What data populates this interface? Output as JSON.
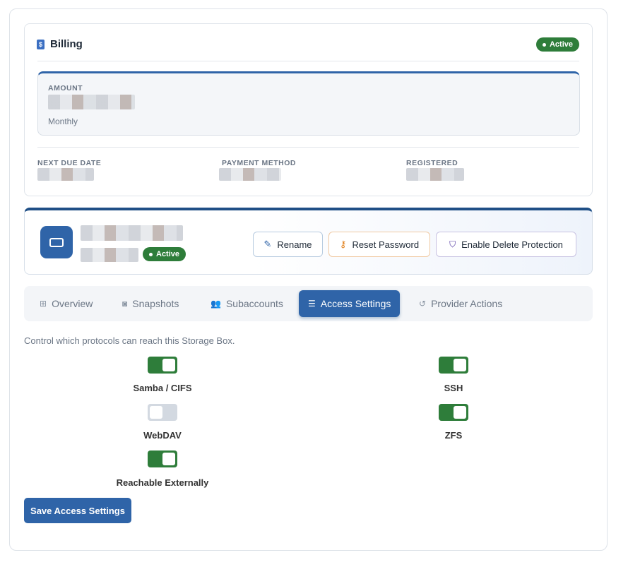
{
  "billing": {
    "title": "Billing",
    "icon": "billing-doc-icon",
    "status": "Active",
    "amount_label": "AMOUNT",
    "amount_period": "Monthly",
    "next_due_label": "NEXT DUE DATE",
    "payment_method_label": "PAYMENT METHOD",
    "registered_label": "REGISTERED"
  },
  "server": {
    "icon": "storage-box-icon",
    "status": "Active",
    "actions": {
      "rename": "Rename",
      "reset_password": "Reset Password",
      "enable_delete_protection": "Enable Delete Protection"
    }
  },
  "tabs": [
    {
      "label": "Overview",
      "icon": "grid-icon"
    },
    {
      "label": "Snapshots",
      "icon": "camera-icon"
    },
    {
      "label": "Subaccounts",
      "icon": "users-icon"
    },
    {
      "label": "Access Settings",
      "icon": "sliders-icon",
      "active": true
    },
    {
      "label": "Provider Actions",
      "icon": "history-icon"
    }
  ],
  "access": {
    "description": "Control which protocols can reach this Storage Box.",
    "toggles": [
      {
        "label": "Samba / CIFS",
        "on": true
      },
      {
        "label": "SSH",
        "on": true
      },
      {
        "label": "WebDAV",
        "on": false
      },
      {
        "label": "ZFS",
        "on": true
      },
      {
        "label": "Reachable Externally",
        "on": true
      }
    ],
    "save_label": "Save Access Settings"
  },
  "colors": {
    "primary": "#2f64a8",
    "success": "#2e7d3a",
    "toggle_off": "#d3d9e1"
  }
}
